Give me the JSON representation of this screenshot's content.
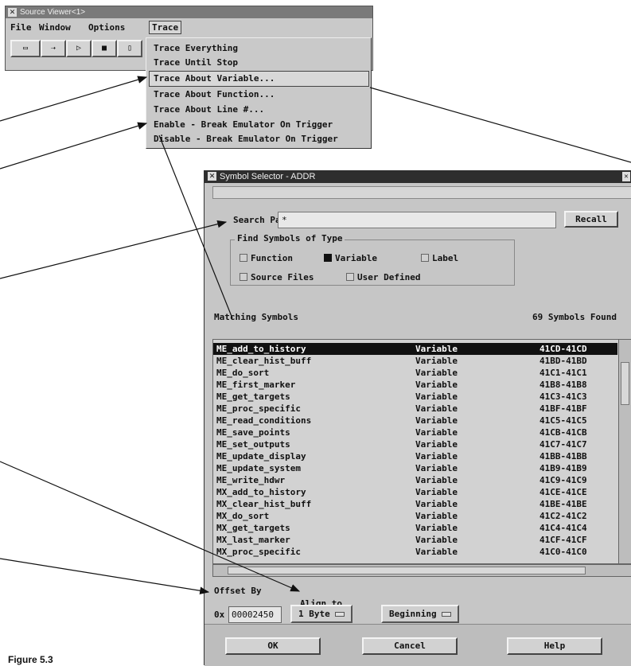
{
  "source_viewer": {
    "title": "Source Viewer<1>",
    "menus": [
      "File",
      "Window",
      "Options",
      "Trace"
    ]
  },
  "trace_menu": {
    "items": [
      "Trace Everything",
      "Trace Until Stop",
      "Trace About Variable...",
      "Trace About Function...",
      "Trace About Line #...",
      "Enable - Break Emulator On Trigger",
      "Disable - Break Emulator On Trigger"
    ]
  },
  "symbol_selector": {
    "title": "Symbol Selector - ADDR",
    "search_label": "Search Pattern:",
    "search_value": "*",
    "recall_button": "Recall",
    "group_title": "Find Symbols of Type",
    "types": [
      {
        "label": "Function",
        "checked": false
      },
      {
        "label": "Variable",
        "checked": true
      },
      {
        "label": "Label",
        "checked": false
      },
      {
        "label": "Source Files",
        "checked": false
      },
      {
        "label": "User Defined",
        "checked": false
      }
    ],
    "matching_label": "Matching Symbols",
    "found_label": "69 Symbols Found",
    "symbols": [
      [
        "ME_add_to_history",
        "Variable",
        "41CD-41CD"
      ],
      [
        "ME_clear_hist_buff",
        "Variable",
        "41BD-41BD"
      ],
      [
        "ME_do_sort",
        "Variable",
        "41C1-41C1"
      ],
      [
        "ME_first_marker",
        "Variable",
        "41B8-41B8"
      ],
      [
        "ME_get_targets",
        "Variable",
        "41C3-41C3"
      ],
      [
        "ME_proc_specific",
        "Variable",
        "41BF-41BF"
      ],
      [
        "ME_read_conditions",
        "Variable",
        "41C5-41C5"
      ],
      [
        "ME_save_points",
        "Variable",
        "41CB-41CB"
      ],
      [
        "ME_set_outputs",
        "Variable",
        "41C7-41C7"
      ],
      [
        "ME_update_display",
        "Variable",
        "41BB-41BB"
      ],
      [
        "ME_update_system",
        "Variable",
        "41B9-41B9"
      ],
      [
        "ME_write_hdwr",
        "Variable",
        "41C9-41C9"
      ],
      [
        "MX_add_to_history",
        "Variable",
        "41CE-41CE"
      ],
      [
        "MX_clear_hist_buff",
        "Variable",
        "41BE-41BE"
      ],
      [
        "MX_do_sort",
        "Variable",
        "41C2-41C2"
      ],
      [
        "MX_get_targets",
        "Variable",
        "41C4-41C4"
      ],
      [
        "MX_last_marker",
        "Variable",
        "41CF-41CF"
      ],
      [
        "MX_proc_specific",
        "Variable",
        "41C0-41C0"
      ]
    ],
    "offset_label": "Offset By",
    "align_label": "Align to",
    "offset_prefix": "0x",
    "offset_value": "00002450",
    "align_size": "1 Byte",
    "align_position": "Beginning",
    "buttons": {
      "ok": "OK",
      "cancel": "Cancel",
      "help": "Help"
    }
  },
  "caption": "Figure 5.3"
}
